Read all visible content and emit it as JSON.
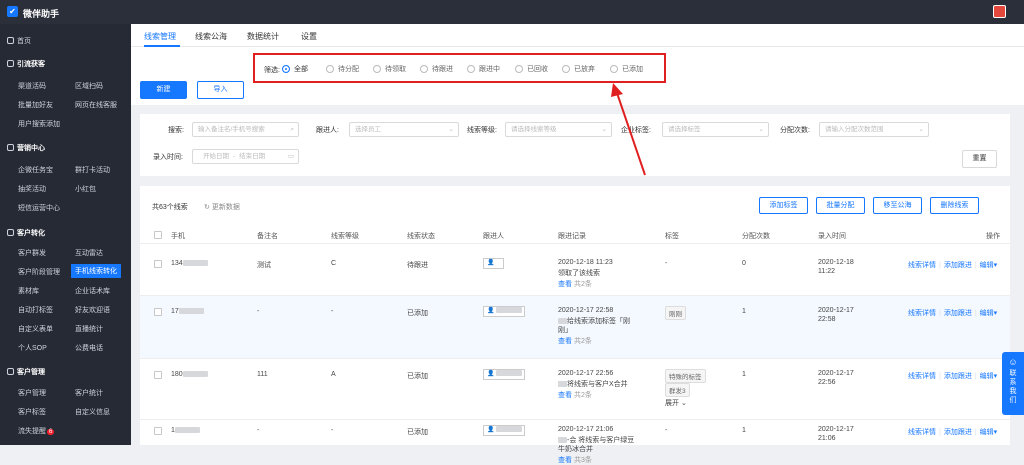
{
  "app": {
    "title": "微伴助手",
    "logo_glyph": "✔"
  },
  "sidebar": {
    "home": "首页",
    "sec_traffic": "引流获客",
    "traffic_items": [
      "渠道活码",
      "区域扫码",
      "批量加好友",
      "网页在线客服",
      "用户搜索添加"
    ],
    "sec_marketing": "营销中心",
    "marketing_items": [
      "企微任务宝",
      "群打卡活动",
      "抽奖活动",
      "小红包",
      "短信运营中心"
    ],
    "sec_convert": "客户转化",
    "convert_items": [
      "客户群发",
      "互动雷达",
      "客户阶段管理",
      "手机线索转化",
      "素材库",
      "企业话术库",
      "自动打标签",
      "好友欢迎语",
      "自定义表单",
      "直播统计",
      "个人SOP",
      "公费电话"
    ],
    "sec_customer": "客户管理",
    "customer_items": [
      "客户管理",
      "客户统计",
      "客户标签",
      "自定义信息",
      "流失提醒"
    ],
    "lost_badge": "6"
  },
  "tabs": [
    "线索管理",
    "线索公海",
    "数据统计",
    "设置"
  ],
  "actions": {
    "new": "新建",
    "import": "导入"
  },
  "filter": {
    "label": "筛选:",
    "options": [
      "全部",
      "待分配",
      "待领取",
      "待跟进",
      "跟进中",
      "已回收",
      "已放弃",
      "已添加"
    ],
    "selected": "全部"
  },
  "search": {
    "search_label": "搜索:",
    "search_ph": "输入备注名/手机号搜索",
    "follower_label": "跟进人:",
    "follower_ph": "选择员工",
    "level_label": "线索等级:",
    "level_ph": "请选择线索等级",
    "tag_label": "企业标签:",
    "tag_ph": "请选择标签",
    "alloc_label": "分配次数:",
    "alloc_ph": "请输入分配次数范围",
    "time_label": "录入时间:",
    "start_ph": "开始日期",
    "to": "-",
    "end_ph": "结束日期",
    "reset": "重置"
  },
  "list": {
    "total": "共63个线索",
    "refresh": "更新数据",
    "bulk_actions": [
      "添加标签",
      "批量分配",
      "移至公海",
      "删除线索"
    ],
    "headers": [
      "手机",
      "备注名",
      "线索等级",
      "线索状态",
      "跟进人",
      "跟进记录",
      "标签",
      "分配次数",
      "录入时间",
      "操作"
    ],
    "view": "查看",
    "detail": "线索详情",
    "add_follow": "添加跟进",
    "edit": "编辑",
    "rows": [
      {
        "phone": "134",
        "remark": "测试",
        "level": "C",
        "status": "待跟进",
        "record_time": "2020-12-18 11:23",
        "record_text": "领取了该线索",
        "record_count": "共2条",
        "tags": [
          "-"
        ],
        "alloc": "0",
        "entry_date": "2020-12-18",
        "entry_time": "11:22"
      },
      {
        "phone": "17",
        "remark": "-",
        "level": "-",
        "status": "已添加",
        "record_time": "2020-12-17 22:58",
        "record_text": "给线索添加标签「刚",
        "record_text2": "刚」",
        "record_count": "共2条",
        "tags": [
          "刚刚"
        ],
        "alloc": "1",
        "entry_date": "2020-12-17",
        "entry_time": "22:58"
      },
      {
        "phone": "180",
        "remark": "111",
        "level": "A",
        "status": "已添加",
        "record_time": "2020-12-17 22:56",
        "record_text": "将线索与客户X合并",
        "record_count": "共2条",
        "tags": [
          "特殊的标签",
          "群发3"
        ],
        "tags_more": "展开",
        "alloc": "1",
        "entry_date": "2020-12-17",
        "entry_time": "22:56"
      },
      {
        "phone": "1",
        "remark": "-",
        "level": "-",
        "status": "已添加",
        "record_time": "2020-12-17 21:06",
        "record_text": "-会 将线索与客户绿豆",
        "record_text2": "牛奶冰合并",
        "record_count": "共3条",
        "tags": [
          "-"
        ],
        "alloc": "1",
        "entry_date": "2020-12-17",
        "entry_time": "21:06"
      }
    ]
  },
  "contact": "联系我们",
  "colors": {
    "primary": "#1677ff",
    "highlight_box": "#e02020",
    "sidebar_bg": "#262a35"
  }
}
